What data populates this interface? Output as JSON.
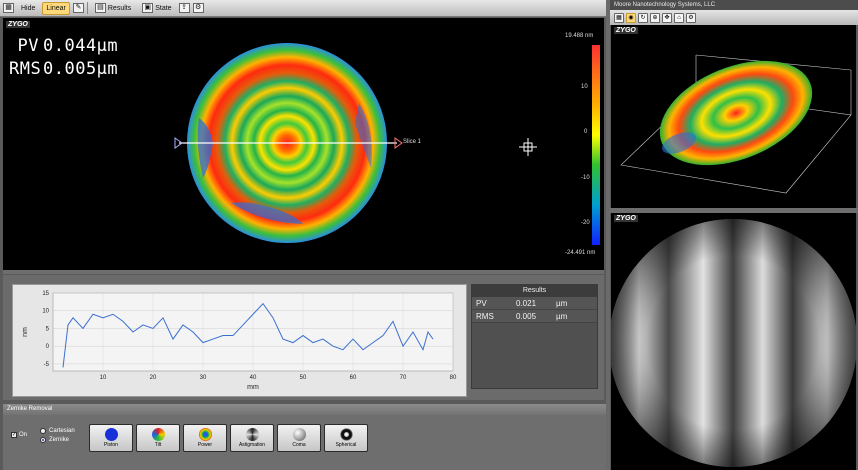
{
  "toolbar": {
    "hide_label": "Hide",
    "linear_label": "Linear",
    "results_label": "Results",
    "state_label": "State"
  },
  "map": {
    "logo": "ZYGO",
    "pv_label": "PV",
    "pv_value": "0.044µm",
    "rms_label": "RMS",
    "rms_value": "0.005µm",
    "slice_label": "Slice 1",
    "scale_max": "19.488 nm",
    "scale_min": "-24.491 nm",
    "scale_ticks": [
      "10",
      "0",
      "-10",
      "-20"
    ]
  },
  "profile": {
    "chart_data": {
      "type": "line",
      "xlabel": "mm",
      "ylabel": "nm",
      "xlim": [
        0,
        80
      ],
      "ylim": [
        -7,
        15
      ],
      "x_ticks": [
        "10",
        "20",
        "30",
        "40",
        "50",
        "60",
        "70",
        "80"
      ],
      "y_ticks": [
        "15",
        "10",
        "5",
        "0",
        "-5"
      ],
      "series": [
        {
          "x": [
            2,
            3,
            4,
            6,
            8,
            10,
            12,
            14,
            16,
            18,
            20,
            22,
            24,
            26,
            28,
            30,
            32,
            34,
            36,
            38,
            40,
            42,
            44,
            46,
            48,
            50,
            52,
            54,
            56,
            58,
            60,
            62,
            64,
            66,
            68,
            70,
            72,
            74,
            75,
            76
          ],
          "values": [
            -6,
            6,
            8,
            5,
            9,
            8,
            9,
            7,
            4,
            6,
            5,
            8,
            2,
            6,
            4,
            1,
            2,
            3,
            3,
            6,
            9,
            12,
            8,
            2,
            1,
            3,
            1,
            2,
            0,
            -1,
            2,
            -1,
            1,
            3,
            7,
            0,
            4,
            -1,
            4,
            2
          ]
        }
      ]
    },
    "results": {
      "header": "Results",
      "rows": [
        {
          "name": "PV",
          "value": "0.021",
          "unit": "µm"
        },
        {
          "name": "RMS",
          "value": "0.005",
          "unit": "µm"
        }
      ]
    }
  },
  "zernike": {
    "title": "Zernike Removal",
    "on_label": "On",
    "cartesian_label": "Cartesian",
    "zernike_label": "Zernike",
    "buttons": [
      "Piston",
      "Tilt",
      "Power",
      "Astigmation",
      "Coma",
      "Spherical"
    ]
  },
  "right": {
    "title": "Moore Nanotechnology Systems, LLC",
    "logo_3d": "ZYGO",
    "logo_fringe": "ZYGO"
  }
}
